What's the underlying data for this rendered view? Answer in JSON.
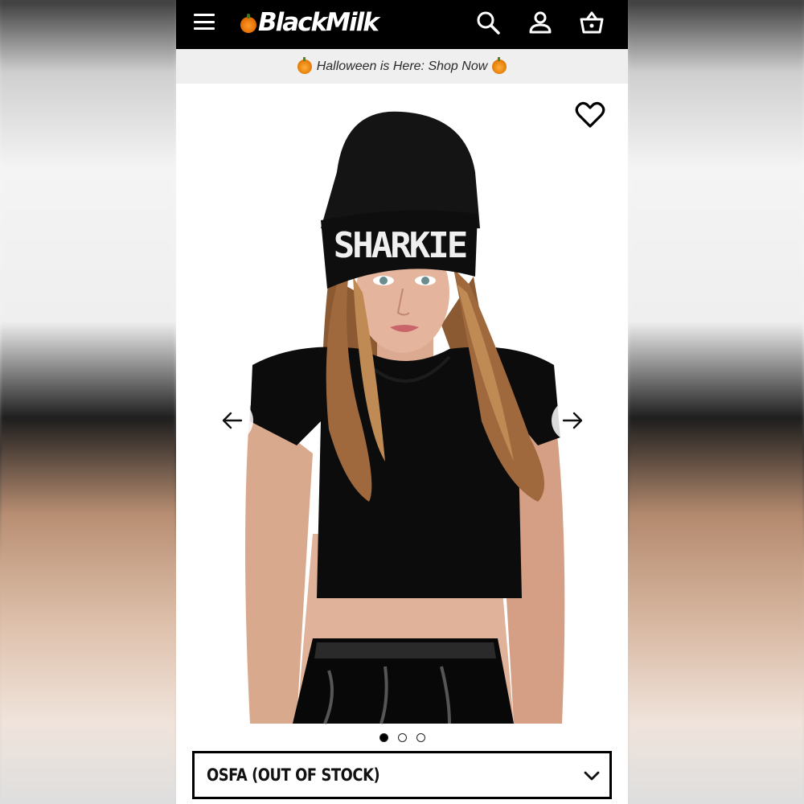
{
  "header": {
    "brand": "BlackMilk",
    "icons": [
      "menu-icon",
      "search-icon",
      "account-icon",
      "basket-icon"
    ]
  },
  "promo": {
    "text": "Halloween is Here: Shop Now"
  },
  "product": {
    "image_alt": "Model wearing black beanie with SHARKIE text and black velvet crop top",
    "beanie_text": "SHARKIE",
    "carousel": {
      "total_slides": 3,
      "active_slide": 1
    },
    "size_select": {
      "selected": "OSFA (OUT OF STOCK)"
    }
  },
  "colors": {
    "header_bg": "#000000",
    "promo_bg": "#efefef",
    "accent_pumpkin": "#e07400"
  }
}
